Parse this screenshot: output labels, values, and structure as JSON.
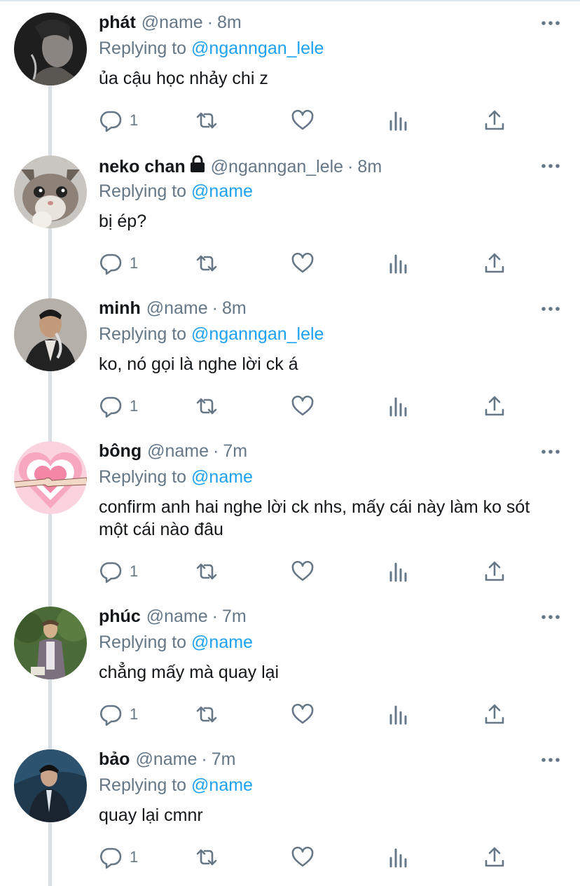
{
  "tweets": [
    {
      "name": "phát",
      "handle": "@name",
      "time": "8m",
      "replying_label": "Replying to",
      "replying_to": "@nganngan_lele",
      "text": "ủa cậu học nhảy chi z",
      "reply_count": "1",
      "locked": false,
      "avatar": "avatar-dark-portrait"
    },
    {
      "name": "neko chan",
      "handle": "@nganngan_lele",
      "time": "8m",
      "replying_label": "Replying to",
      "replying_to": "@name",
      "text": "bị ép?",
      "reply_count": "1",
      "locked": true,
      "avatar": "avatar-cat"
    },
    {
      "name": "minh",
      "handle": "@name",
      "time": "8m",
      "replying_label": "Replying to",
      "replying_to": "@nganngan_lele",
      "text": "ko, nó gọi là nghe lời ck á",
      "reply_count": "1",
      "locked": false,
      "avatar": "avatar-man-suit"
    },
    {
      "name": "bông",
      "handle": "@name",
      "time": "7m",
      "replying_label": "Replying to",
      "replying_to": "@name",
      "text": "confirm anh hai nghe lời ck nhs, mấy cái này làm ko sót một cái nào đâu",
      "reply_count": "1",
      "locked": false,
      "avatar": "avatar-pink-heart"
    },
    {
      "name": "phúc",
      "handle": "@name",
      "time": "7m",
      "replying_label": "Replying to",
      "replying_to": "@name",
      "text": "chẳng mấy mà quay lại",
      "reply_count": "1",
      "locked": false,
      "avatar": "avatar-man-garden"
    },
    {
      "name": "bảo",
      "handle": "@name",
      "time": "7m",
      "replying_label": "Replying to",
      "replying_to": "@name",
      "text": "quay lại cmnr",
      "reply_count": "1",
      "locked": false,
      "avatar": "avatar-man-blue"
    }
  ],
  "colors": {
    "link": "#1da1f2",
    "secondary_text": "#657786",
    "primary_text": "#14171a",
    "thread_line": "#d9dfe3"
  }
}
